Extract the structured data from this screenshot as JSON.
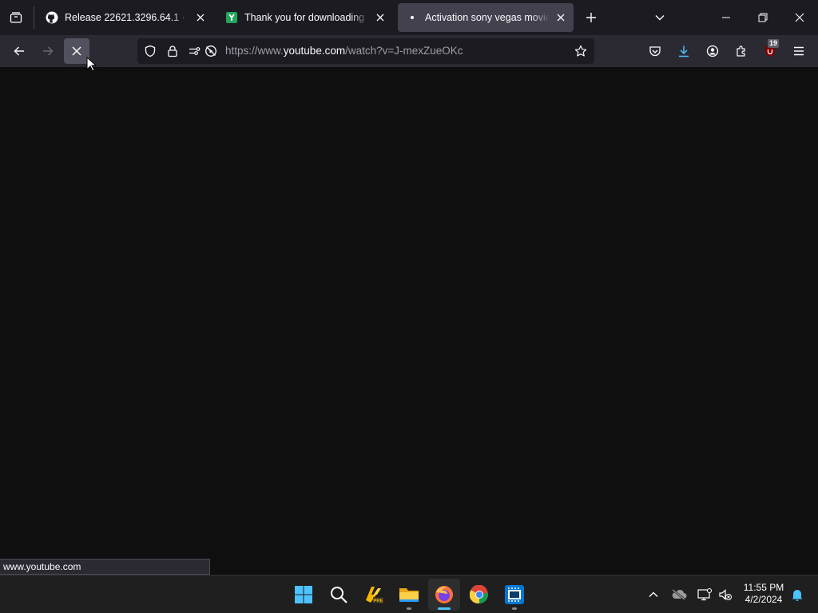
{
  "tabs": [
    {
      "title": "Release 22621.3296.64.1 · valinet/",
      "icon": "github-icon",
      "active": false
    },
    {
      "title": "Thank you for downloading Soft",
      "icon": "softonic-icon",
      "active": false
    },
    {
      "title": "Activation sony vegas movie stu",
      "icon": "loading-dot-icon",
      "active": true
    }
  ],
  "url": {
    "prefix": "https://www.",
    "domain": "youtube.com",
    "path": "/watch?v=J-mexZueOKc"
  },
  "status_link": "www.youtube.com",
  "extension_badge": "19",
  "clock": {
    "time": "11:55 PM",
    "date": "4/2/2024"
  },
  "colors": {
    "chrome": "#1c1b22",
    "toolbar": "#2b2a33",
    "active_tab": "#42414d",
    "page_bg": "#0f0f0f",
    "accent": "#4cc2ff",
    "ublock_red": "#800000"
  }
}
